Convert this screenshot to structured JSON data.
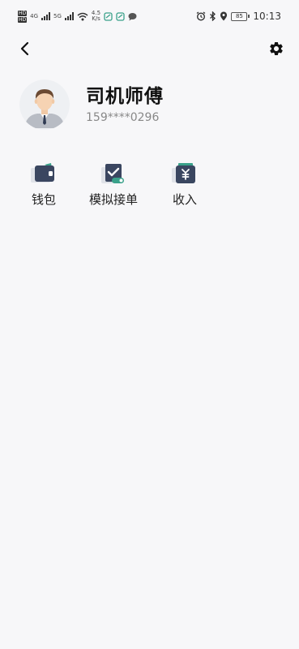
{
  "status_bar": {
    "hd_top": "HD",
    "hd_bottom": "HD",
    "net_a": "4G",
    "net_b": "5G",
    "speed_value": "4.5",
    "speed_unit": "K/s",
    "battery_level": "85",
    "time": "10:13"
  },
  "profile": {
    "name": "司机师傅",
    "phone": "159****0296"
  },
  "menu": {
    "items": [
      {
        "label": "钱包",
        "icon": "wallet-icon"
      },
      {
        "label": "模拟接单",
        "icon": "mock-order-icon"
      },
      {
        "label": "收入",
        "icon": "income-icon"
      }
    ]
  },
  "colors": {
    "background": "#f7f7f9",
    "icon_dark": "#3a4660",
    "icon_accent": "#3aa18a"
  }
}
